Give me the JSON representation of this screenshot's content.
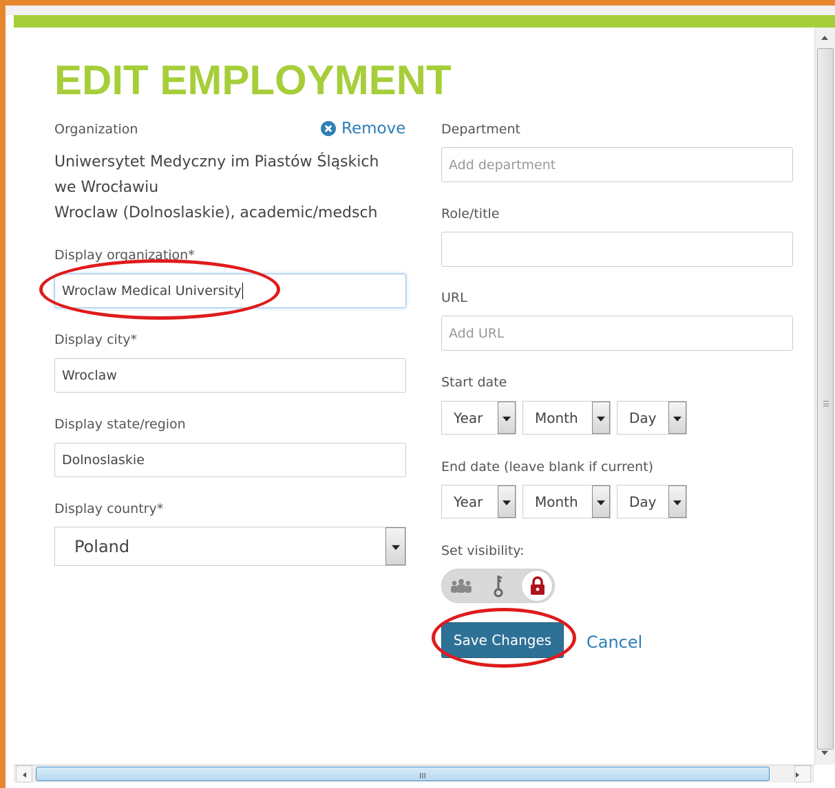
{
  "page": {
    "title": "EDIT EMPLOYMENT",
    "accent_color": "#a6ce39",
    "link_color": "#2e7eb7"
  },
  "organization": {
    "label": "Organization",
    "remove_label": "Remove",
    "name_line1": "Uniwersytet Medyczny im Piastów Śląskich",
    "name_line2": "we Wrocławiu",
    "location_line": "Wroclaw (Dolnoslaskie), academic/medsch"
  },
  "display_organization": {
    "label": "Display organization*",
    "value": "Wroclaw Medical University"
  },
  "display_city": {
    "label": "Display city*",
    "value": "Wroclaw"
  },
  "display_state": {
    "label": "Display state/region",
    "value": "Dolnoslaskie"
  },
  "display_country": {
    "label": "Display country*",
    "value": "Poland"
  },
  "department": {
    "label": "Department",
    "placeholder": "Add department"
  },
  "role": {
    "label": "Role/title",
    "value": ""
  },
  "url": {
    "label": "URL",
    "placeholder": "Add URL"
  },
  "start_date": {
    "label": "Start date",
    "year": "Year",
    "month": "Month",
    "day": "Day"
  },
  "end_date": {
    "label": "End date (leave blank if current)",
    "year": "Year",
    "month": "Month",
    "day": "Day"
  },
  "visibility": {
    "label": "Set visibility:",
    "options": [
      "everyone-icon",
      "key-icon",
      "lock-icon"
    ],
    "selected": "lock-icon"
  },
  "actions": {
    "save_label": "Save Changes",
    "cancel_label": "Cancel"
  },
  "scrollbar": {
    "grip": "III"
  }
}
